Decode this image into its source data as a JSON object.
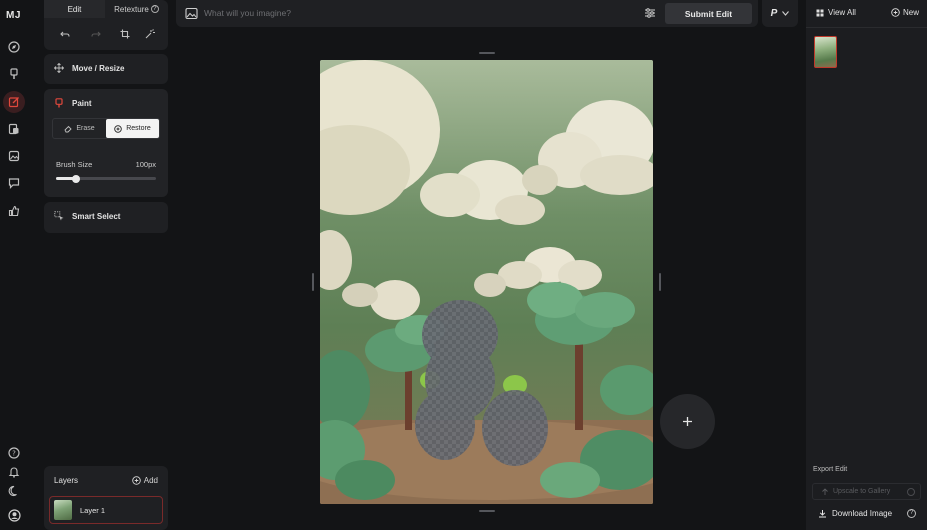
{
  "app": {
    "logo": "MJ"
  },
  "tabs": {
    "edit": "Edit",
    "retexture": "Retexture"
  },
  "tools": {
    "move_resize": "Move / Resize",
    "paint": {
      "title": "Paint",
      "erase": "Erase",
      "restore": "Restore",
      "active_mode": "Restore",
      "brush_size_label": "Brush Size",
      "brush_size_value": "100px",
      "brush_level": 0.2
    },
    "smart_select": "Smart Select"
  },
  "layers": {
    "title": "Layers",
    "add_label": "Add",
    "items": [
      {
        "label": "Layer 1",
        "selected": true
      }
    ]
  },
  "prompt": {
    "placeholder": "What will you imagine?",
    "submit_label": "Submit Edit",
    "mode_label": "P"
  },
  "right_panel": {
    "view_all": "View All",
    "new_label": "New",
    "export_label": "Export Edit",
    "upscale_label": "Upscale to Gallery",
    "download_label": "Download Image"
  },
  "colors": {
    "accent": "#c0392b",
    "panel": "#1f2023",
    "background": "#131416"
  },
  "icons": {
    "rail": [
      "explore-icon",
      "paint-brush-icon",
      "edit-icon",
      "organize-icon",
      "image-icon",
      "chat-icon",
      "thumbs-up-icon",
      "help-icon",
      "bell-icon",
      "moon-icon",
      "profile-icon"
    ],
    "toolbar": [
      "undo-icon",
      "redo-icon",
      "crop-icon",
      "magic-icon"
    ]
  }
}
